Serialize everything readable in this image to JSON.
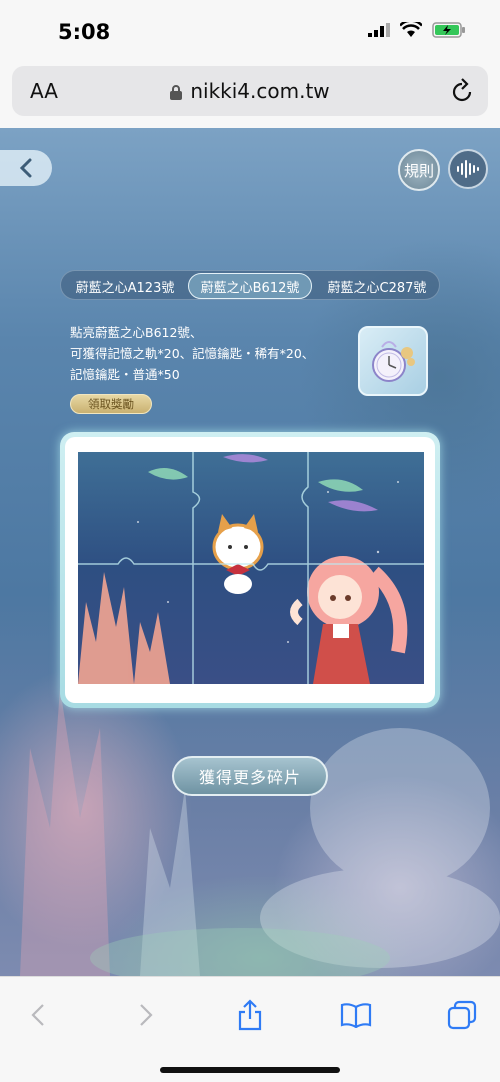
{
  "status": {
    "time": "5:08"
  },
  "browser": {
    "aa": "AA",
    "url": "nikki4.com.tw"
  },
  "game": {
    "rules_label": "規則",
    "tabs": [
      "蔚藍之心A123號",
      "蔚藍之心B612號",
      "蔚藍之心C287號"
    ],
    "selected_tab": 1,
    "desc_lines": [
      "點亮蔚藍之心B612號、",
      "可獲得記憶之軌*20、記憶鑰匙・稀有*20、",
      "記憶鑰匙・普通*50"
    ],
    "claim_label": "領取獎勵",
    "more_label": "獲得更多碎片"
  },
  "icons": {
    "back": "chevron-left-icon",
    "audio": "audio-wave-icon",
    "reward": "pocket-watch-icon",
    "share": "share-icon",
    "bookmarks": "book-icon",
    "tabs": "tabs-icon"
  },
  "colors": {
    "accent": "#6f93a3",
    "claim": "#c9b171",
    "ios_blue": "#2f7bf5"
  }
}
